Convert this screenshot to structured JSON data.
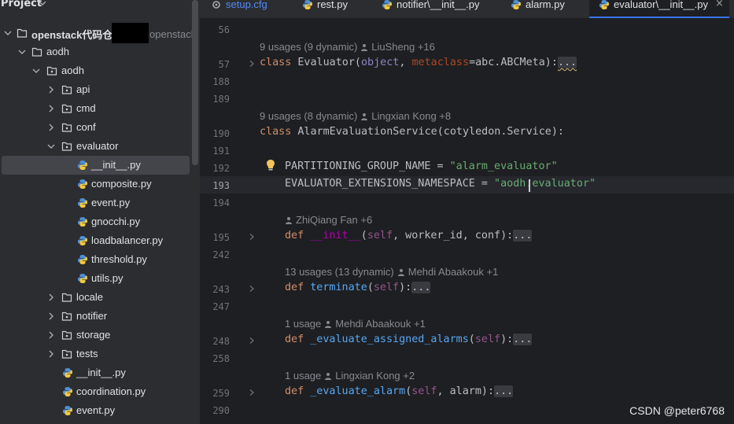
{
  "project_panel": {
    "title": "Project",
    "root_label": "openstack代码仓",
    "root_extra": "openstack",
    "items": [
      {
        "label": "aodh"
      },
      {
        "label": "aodh"
      },
      {
        "label": "api"
      },
      {
        "label": "cmd"
      },
      {
        "label": "conf"
      },
      {
        "label": "evaluator"
      },
      {
        "label": "__init__.py"
      },
      {
        "label": "composite.py"
      },
      {
        "label": "event.py"
      },
      {
        "label": "gnocchi.py"
      },
      {
        "label": "loadbalancer.py"
      },
      {
        "label": "threshold.py"
      },
      {
        "label": "utils.py"
      },
      {
        "label": "locale"
      },
      {
        "label": "notifier"
      },
      {
        "label": "storage"
      },
      {
        "label": "tests"
      },
      {
        "label": "__init__.py"
      },
      {
        "label": "coordination.py"
      },
      {
        "label": "event.py"
      }
    ]
  },
  "tabs": [
    {
      "label": "setup.cfg"
    },
    {
      "label": "rest.py"
    },
    {
      "label": "notifier\\__init__.py"
    },
    {
      "label": "alarm.py"
    },
    {
      "label": "evaluator\\__init__.py",
      "close": "×"
    }
  ],
  "editor": {
    "line_numbers": [
      "56",
      "57",
      "188",
      "189",
      "190",
      "191",
      "192",
      "193",
      "194",
      "195",
      "242",
      "243",
      "247",
      "248",
      "258",
      "259",
      "290"
    ],
    "hints": {
      "evaluator_usages": "9 usages (9 dynamic)",
      "evaluator_author": "LiuSheng +16",
      "service_usages": "9 usages (8 dynamic)",
      "service_author": "Lingxian Kong +8",
      "init_author": "ZhiQiang Fan +6",
      "terminate_usages": "13 usages (13 dynamic)",
      "terminate_author": "Mehdi Abaakouk +1",
      "assigned_usages": "1 usage",
      "assigned_author": "Mehdi Abaakouk +1",
      "evalalarm_usages": "1 usage",
      "evalalarm_author": "Lingxian Kong +2"
    },
    "code": {
      "l57_kw": "class",
      "l57_name": " Evaluator(",
      "l57_object": "object",
      "l57_sep": ", ",
      "l57_meta": "metaclass",
      "l57_rest": "=abc.ABCMeta):",
      "ellipsis": "...",
      "l190_kw": "class",
      "l190_rest": " AlarmEvaluationService(cotyledon.Service):",
      "l192_name": "PARTITIONING_GROUP_NAME = ",
      "l192_str": "\"alarm_evaluator\"",
      "l193_name": "EVALUATOR_EXTENSIONS_NAMESPACE = ",
      "l193_str": "\"aodh.evaluator\"",
      "def": "def",
      "l195_fn": "__init__",
      "open_paren": "(",
      "self": "self",
      "l195_rest": ", worker_id, conf):",
      "l243_fn": "terminate",
      "close_colon": "):",
      "l248_fn": "_evaluate_assigned_alarms",
      "l259_fn": "_evaluate_alarm",
      "l259_rest": ", alarm):"
    }
  },
  "watermark": "CSDN @peter6768",
  "colors": {
    "background": "#1e1f22",
    "panel": "#2b2d30",
    "keyword": "#cf8e6d",
    "string": "#6aab73",
    "function": "#56a8f5",
    "self": "#94558d",
    "accent": "#3574f0"
  }
}
